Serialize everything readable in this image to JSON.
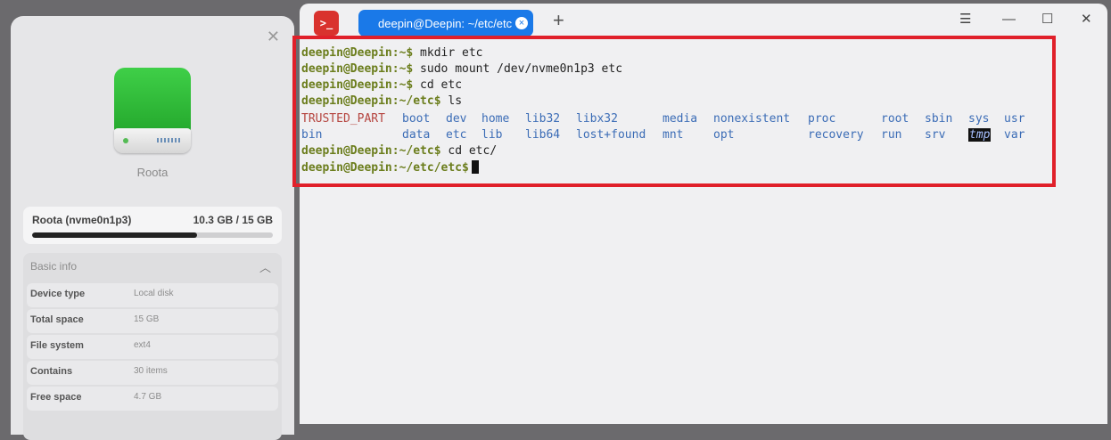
{
  "properties": {
    "volume_name": "Roota",
    "usage": {
      "label": "Roota (nvme0n1p3)",
      "value": "10.3 GB / 15 GB",
      "fraction": 0.687
    },
    "basic_info": {
      "header": "Basic info",
      "rows": [
        {
          "key": "Device type",
          "value": "Local disk"
        },
        {
          "key": "Total space",
          "value": "15 GB"
        },
        {
          "key": "File system",
          "value": "ext4"
        },
        {
          "key": "Contains",
          "value": "30 items"
        },
        {
          "key": "Free space",
          "value": "4.7 GB"
        }
      ]
    }
  },
  "terminal": {
    "app_icon": ">_",
    "tab_title": "deepin@Deepin: ~/etc/etc",
    "new_tab_glyph": "+",
    "menu_glyph": "☰",
    "lines": [
      {
        "prompt": "deepin@Deepin:~$",
        "command": " mkdir etc"
      },
      {
        "prompt": "deepin@Deepin:~$",
        "command": " sudo mount /dev/nvme0n1p3 etc"
      },
      {
        "prompt": "deepin@Deepin:~$",
        "command": " cd etc"
      },
      {
        "prompt": "deepin@Deepin:~/etc$",
        "command": " ls"
      }
    ],
    "ls_row1": [
      "TRUSTED_PART",
      "boot",
      "dev",
      "home",
      "lib32",
      "libx32",
      "media",
      "nonexistent",
      "proc",
      "root",
      "sbin",
      "sys",
      "usr"
    ],
    "ls_row2": [
      "bin",
      "data",
      "etc",
      "lib",
      "lib64",
      "lost+found",
      "mnt",
      "opt",
      "recovery",
      "run",
      "srv",
      "tmp",
      "var"
    ],
    "line_after_ls": {
      "prompt": "deepin@Deepin:~/etc$",
      "command": " cd etc/"
    },
    "current_prompt": "deepin@Deepin:~/etc/etc$"
  },
  "colors": {
    "prompt": "#6b7d1c",
    "directory": "#3b6cb6",
    "trusted_part": "#b5443f",
    "tab_active": "#1a79e8",
    "highlight": "#e0202a",
    "disk_green": "#2fbf38"
  }
}
